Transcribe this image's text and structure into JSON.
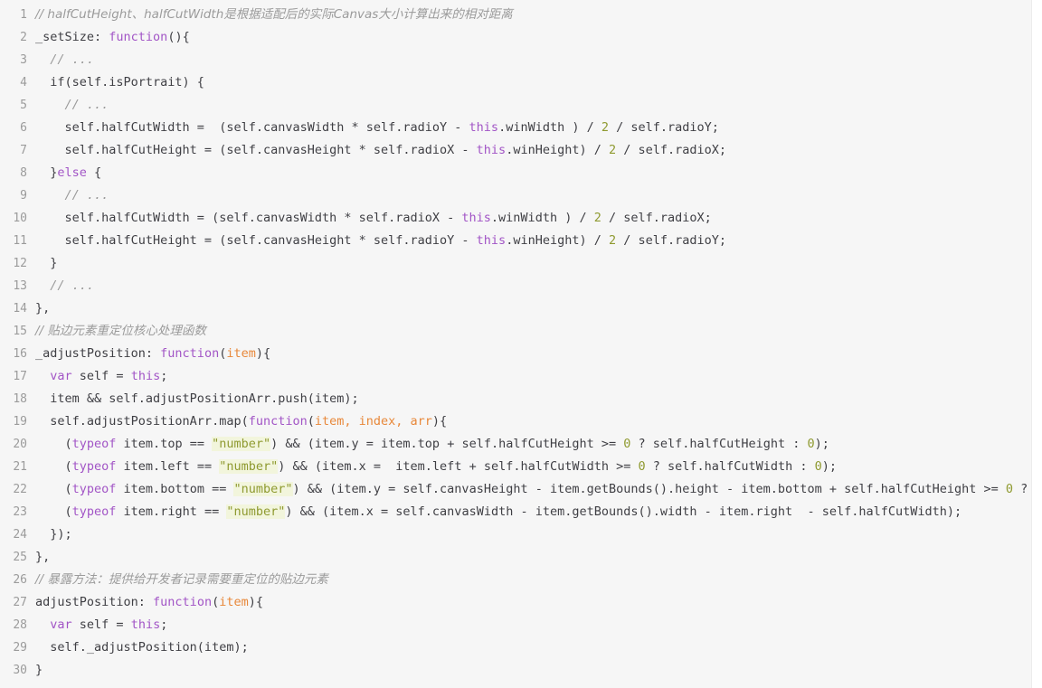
{
  "editor": {
    "background_color": "#f6f6f6",
    "gutter_color": "#9b9b9b",
    "text_color": "#3f3f44",
    "comment_color": "#9b9b9b",
    "keyword_color": "#a255c6",
    "param_color": "#e8883a",
    "string_color": "#8f9a30",
    "string_bg_color": "#f2f5dc",
    "number_color": "#8f9a30",
    "language": "javascript",
    "first_line_number": 1,
    "last_line_number": 30,
    "total_lines": 30
  },
  "lines": [
    {
      "n": "1",
      "tokens": [
        {
          "t": "// halfCutHeight、halfCutWidth是根据适配后的实际Canvas大小计算出来的相对距离",
          "c": "t-com"
        }
      ]
    },
    {
      "n": "2",
      "tokens": [
        {
          "t": "_setSize: ",
          "c": "t-pln"
        },
        {
          "t": "function",
          "c": "t-key"
        },
        {
          "t": "(){",
          "c": "t-pln"
        }
      ]
    },
    {
      "n": "3",
      "tokens": [
        {
          "t": "  ",
          "c": "t-pln"
        },
        {
          "t": "// ...",
          "c": "t-com"
        }
      ]
    },
    {
      "n": "4",
      "tokens": [
        {
          "t": "  if(self.isPortrait) {",
          "c": "t-pln"
        }
      ]
    },
    {
      "n": "5",
      "tokens": [
        {
          "t": "    ",
          "c": "t-pln"
        },
        {
          "t": "// ...",
          "c": "t-com"
        }
      ]
    },
    {
      "n": "6",
      "tokens": [
        {
          "t": "    self.halfCutWidth =  (self.canvasWidth * self.radioY - ",
          "c": "t-pln"
        },
        {
          "t": "this",
          "c": "t-key"
        },
        {
          "t": ".winWidth ) / ",
          "c": "t-pln"
        },
        {
          "t": "2",
          "c": "t-num"
        },
        {
          "t": " / self.radioY;",
          "c": "t-pln"
        }
      ]
    },
    {
      "n": "7",
      "tokens": [
        {
          "t": "    self.halfCutHeight = (self.canvasHeight * self.radioX - ",
          "c": "t-pln"
        },
        {
          "t": "this",
          "c": "t-key"
        },
        {
          "t": ".winHeight) / ",
          "c": "t-pln"
        },
        {
          "t": "2",
          "c": "t-num"
        },
        {
          "t": " / self.radioX;",
          "c": "t-pln"
        }
      ]
    },
    {
      "n": "8",
      "tokens": [
        {
          "t": "  }",
          "c": "t-pln"
        },
        {
          "t": "else",
          "c": "t-key"
        },
        {
          "t": " {",
          "c": "t-pln"
        }
      ]
    },
    {
      "n": "9",
      "tokens": [
        {
          "t": "    ",
          "c": "t-pln"
        },
        {
          "t": "// ...",
          "c": "t-com"
        }
      ]
    },
    {
      "n": "10",
      "tokens": [
        {
          "t": "    self.halfCutWidth = (self.canvasWidth * self.radioX - ",
          "c": "t-pln"
        },
        {
          "t": "this",
          "c": "t-key"
        },
        {
          "t": ".winWidth ) / ",
          "c": "t-pln"
        },
        {
          "t": "2",
          "c": "t-num"
        },
        {
          "t": " / self.radioX;",
          "c": "t-pln"
        }
      ]
    },
    {
      "n": "11",
      "tokens": [
        {
          "t": "    self.halfCutHeight = (self.canvasHeight * self.radioY - ",
          "c": "t-pln"
        },
        {
          "t": "this",
          "c": "t-key"
        },
        {
          "t": ".winHeight) / ",
          "c": "t-pln"
        },
        {
          "t": "2",
          "c": "t-num"
        },
        {
          "t": " / self.radioY;",
          "c": "t-pln"
        }
      ]
    },
    {
      "n": "12",
      "tokens": [
        {
          "t": "  }",
          "c": "t-pln"
        }
      ]
    },
    {
      "n": "13",
      "tokens": [
        {
          "t": "  ",
          "c": "t-pln"
        },
        {
          "t": "// ...",
          "c": "t-com"
        }
      ]
    },
    {
      "n": "14",
      "tokens": [
        {
          "t": "},",
          "c": "t-pln"
        }
      ]
    },
    {
      "n": "15",
      "tokens": [
        {
          "t": "// 贴边元素重定位核心处理函数",
          "c": "t-com"
        }
      ]
    },
    {
      "n": "16",
      "tokens": [
        {
          "t": "_adjustPosition: ",
          "c": "t-pln"
        },
        {
          "t": "function",
          "c": "t-key"
        },
        {
          "t": "(",
          "c": "t-pln"
        },
        {
          "t": "item",
          "c": "t-par"
        },
        {
          "t": "){",
          "c": "t-pln"
        }
      ]
    },
    {
      "n": "17",
      "tokens": [
        {
          "t": "  ",
          "c": "t-pln"
        },
        {
          "t": "var",
          "c": "t-key"
        },
        {
          "t": " self = ",
          "c": "t-pln"
        },
        {
          "t": "this",
          "c": "t-key"
        },
        {
          "t": ";",
          "c": "t-pln"
        }
      ]
    },
    {
      "n": "18",
      "tokens": [
        {
          "t": "  item && self.adjustPositionArr.push(item);",
          "c": "t-pln"
        }
      ]
    },
    {
      "n": "19",
      "tokens": [
        {
          "t": "  self.adjustPositionArr.map(",
          "c": "t-pln"
        },
        {
          "t": "function",
          "c": "t-key"
        },
        {
          "t": "(",
          "c": "t-pln"
        },
        {
          "t": "item, index, arr",
          "c": "t-par"
        },
        {
          "t": "){",
          "c": "t-pln"
        }
      ]
    },
    {
      "n": "20",
      "tokens": [
        {
          "t": "    (",
          "c": "t-pln"
        },
        {
          "t": "typeof",
          "c": "t-key"
        },
        {
          "t": " item.top == ",
          "c": "t-pln"
        },
        {
          "t": "\"number\"",
          "c": "t-str"
        },
        {
          "t": ") && (item.y = item.top + self.halfCutHeight >= ",
          "c": "t-pln"
        },
        {
          "t": "0",
          "c": "t-num"
        },
        {
          "t": " ? self.halfCutHeight : ",
          "c": "t-pln"
        },
        {
          "t": "0",
          "c": "t-num"
        },
        {
          "t": ");",
          "c": "t-pln"
        }
      ]
    },
    {
      "n": "21",
      "tokens": [
        {
          "t": "    (",
          "c": "t-pln"
        },
        {
          "t": "typeof",
          "c": "t-key"
        },
        {
          "t": " item.left == ",
          "c": "t-pln"
        },
        {
          "t": "\"number\"",
          "c": "t-str"
        },
        {
          "t": ") && (item.x =  item.left + self.halfCutWidth >= ",
          "c": "t-pln"
        },
        {
          "t": "0",
          "c": "t-num"
        },
        {
          "t": " ? self.halfCutWidth : ",
          "c": "t-pln"
        },
        {
          "t": "0",
          "c": "t-num"
        },
        {
          "t": ");",
          "c": "t-pln"
        }
      ]
    },
    {
      "n": "22",
      "tokens": [
        {
          "t": "    (",
          "c": "t-pln"
        },
        {
          "t": "typeof",
          "c": "t-key"
        },
        {
          "t": " item.bottom == ",
          "c": "t-pln"
        },
        {
          "t": "\"number\"",
          "c": "t-str"
        },
        {
          "t": ") && (item.y = self.canvasHeight - item.getBounds().height - item.bottom + self.halfCutHeight >= ",
          "c": "t-pln"
        },
        {
          "t": "0",
          "c": "t-num"
        },
        {
          "t": " ?",
          "c": "t-pln"
        }
      ]
    },
    {
      "n": "23",
      "tokens": [
        {
          "t": "    (",
          "c": "t-pln"
        },
        {
          "t": "typeof",
          "c": "t-key"
        },
        {
          "t": " item.right == ",
          "c": "t-pln"
        },
        {
          "t": "\"number\"",
          "c": "t-str"
        },
        {
          "t": ") && (item.x = self.canvasWidth - item.getBounds().width - item.right  - self.halfCutWidth);",
          "c": "t-pln"
        }
      ]
    },
    {
      "n": "24",
      "tokens": [
        {
          "t": "  });",
          "c": "t-pln"
        }
      ]
    },
    {
      "n": "25",
      "tokens": [
        {
          "t": "},",
          "c": "t-pln"
        }
      ]
    },
    {
      "n": "26",
      "tokens": [
        {
          "t": "// 暴露方法：提供给开发者记录需要重定位的贴边元素",
          "c": "t-com"
        }
      ]
    },
    {
      "n": "27",
      "tokens": [
        {
          "t": "adjustPosition: ",
          "c": "t-pln"
        },
        {
          "t": "function",
          "c": "t-key"
        },
        {
          "t": "(",
          "c": "t-pln"
        },
        {
          "t": "item",
          "c": "t-par"
        },
        {
          "t": "){",
          "c": "t-pln"
        }
      ]
    },
    {
      "n": "28",
      "tokens": [
        {
          "t": "  ",
          "c": "t-pln"
        },
        {
          "t": "var",
          "c": "t-key"
        },
        {
          "t": " self = ",
          "c": "t-pln"
        },
        {
          "t": "this",
          "c": "t-key"
        },
        {
          "t": ";",
          "c": "t-pln"
        }
      ]
    },
    {
      "n": "29",
      "tokens": [
        {
          "t": "  self._adjustPosition(item);",
          "c": "t-pln"
        }
      ]
    },
    {
      "n": "30",
      "tokens": [
        {
          "t": "}",
          "c": "t-pln"
        }
      ]
    }
  ]
}
